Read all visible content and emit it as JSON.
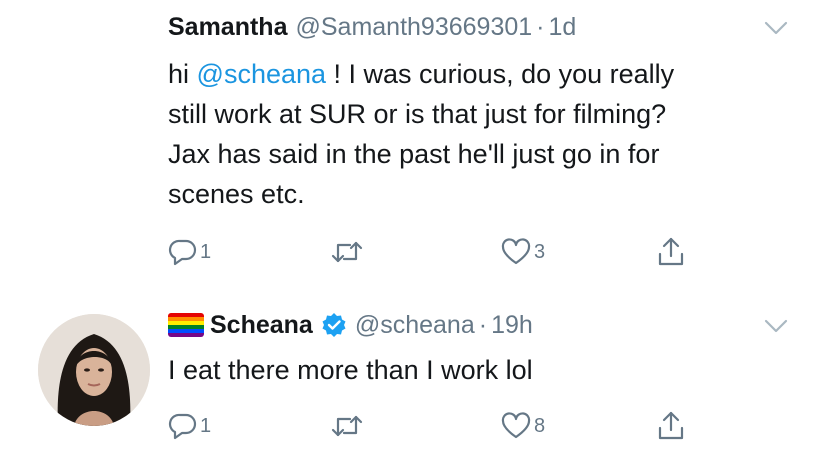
{
  "tweets": [
    {
      "display_name": "Samantha",
      "handle": "@Samanth93669301",
      "separator": "·",
      "time": "1d",
      "text": {
        "prefix": "hi ",
        "mention": "@scheana",
        "rest_line1": " ! I was curious, do you really",
        "line2": "still work at SUR or is that just for filming?",
        "line3": "Jax has said in the past he'll just go in for",
        "line4": "scenes etc."
      },
      "actions": {
        "replies": "1",
        "retweets": "",
        "likes": "3"
      }
    },
    {
      "display_name": "Scheana",
      "handle": "@scheana",
      "separator": "·",
      "time": "19h",
      "verified": true,
      "text": "I eat there more than I work lol",
      "actions": {
        "replies": "1",
        "retweets": "",
        "likes": "8"
      }
    }
  ],
  "icons": {
    "reply": "reply-icon",
    "retweet": "retweet-icon",
    "like": "heart-icon",
    "share": "share-icon",
    "menu": "chevron-down-icon",
    "verified": "verified-badge-icon",
    "flag": "rainbow-flag-icon"
  },
  "colors": {
    "text": "#14171a",
    "secondary": "#657786",
    "link": "#1b95e0",
    "icon": "#657786"
  }
}
